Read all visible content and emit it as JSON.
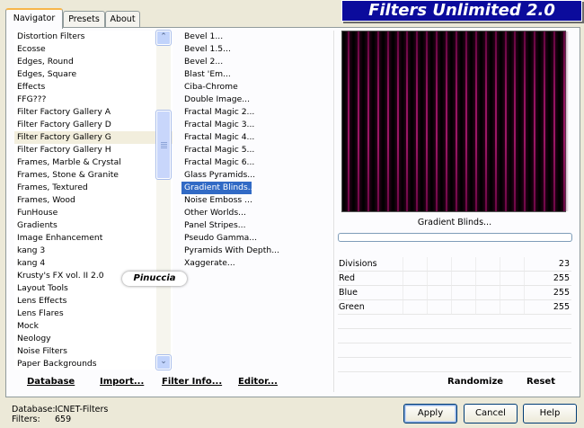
{
  "tabs": [
    "Navigator",
    "Presets",
    "About"
  ],
  "logo": "Filters Unlimited 2.0",
  "categories": [
    "Distortion Filters",
    "Ecosse",
    "Edges, Round",
    "Edges, Square",
    "Effects",
    "FFG???",
    "Filter Factory Gallery A",
    "Filter Factory Gallery D",
    "Filter Factory Gallery G",
    "Filter Factory Gallery H",
    "Frames, Marble & Crystal",
    "Frames, Stone & Granite",
    "Frames, Textured",
    "Frames, Wood",
    "FunHouse",
    "Gradients",
    "Image Enhancement",
    "kang 3",
    "kang 4",
    "Krusty's FX vol. II 2.0",
    "Layout Tools",
    "Lens Effects",
    "Lens Flares",
    "Mock",
    "Neology",
    "Noise Filters",
    "Paper Backgrounds"
  ],
  "selected_category": "Filter Factory Gallery G",
  "filters": [
    "Bevel 1...",
    "Bevel 1.5...",
    "Bevel 2...",
    "Blast 'Em...",
    "Ciba-Chrome",
    "Double Image...",
    "Fractal Magic 2...",
    "Fractal Magic 3...",
    "Fractal Magic 4...",
    "Fractal Magic 5...",
    "Fractal Magic 6...",
    "Glass Pyramids...",
    "Gradient Blinds...",
    "Noise Emboss ...",
    "Other Worlds...",
    "Panel Stripes...",
    "Pseudo Gamma...",
    "Pyramids With Depth...",
    "Xaggerate..."
  ],
  "selected_filter": "Gradient Blinds...",
  "filter_name": "Gradient Blinds...",
  "params": [
    {
      "name": "Divisions",
      "value": "23"
    },
    {
      "name": "Red",
      "value": "255"
    },
    {
      "name": "Blue",
      "value": "255"
    },
    {
      "name": "Green",
      "value": "255"
    }
  ],
  "bottom_links": {
    "database": "Database",
    "import": "Import...",
    "filter_info": "Filter Info...",
    "editor": "Editor...",
    "randomize": "Randomize",
    "reset": "Reset"
  },
  "status": {
    "database_label": "Database:",
    "database_value": "ICNET-Filters",
    "filters_label": "Filters:",
    "filters_value": "659"
  },
  "buttons": {
    "apply": "Apply",
    "cancel": "Cancel",
    "help": "Help"
  },
  "watermark": "Pinuccia",
  "scroll_glyphs": {
    "up": "⌃",
    "down": "⌄"
  },
  "preview_blind_count": 23,
  "colors": {
    "accent": "#316ac5",
    "logo_bg": "#0b0b9c",
    "blind": "#d02a8a"
  }
}
